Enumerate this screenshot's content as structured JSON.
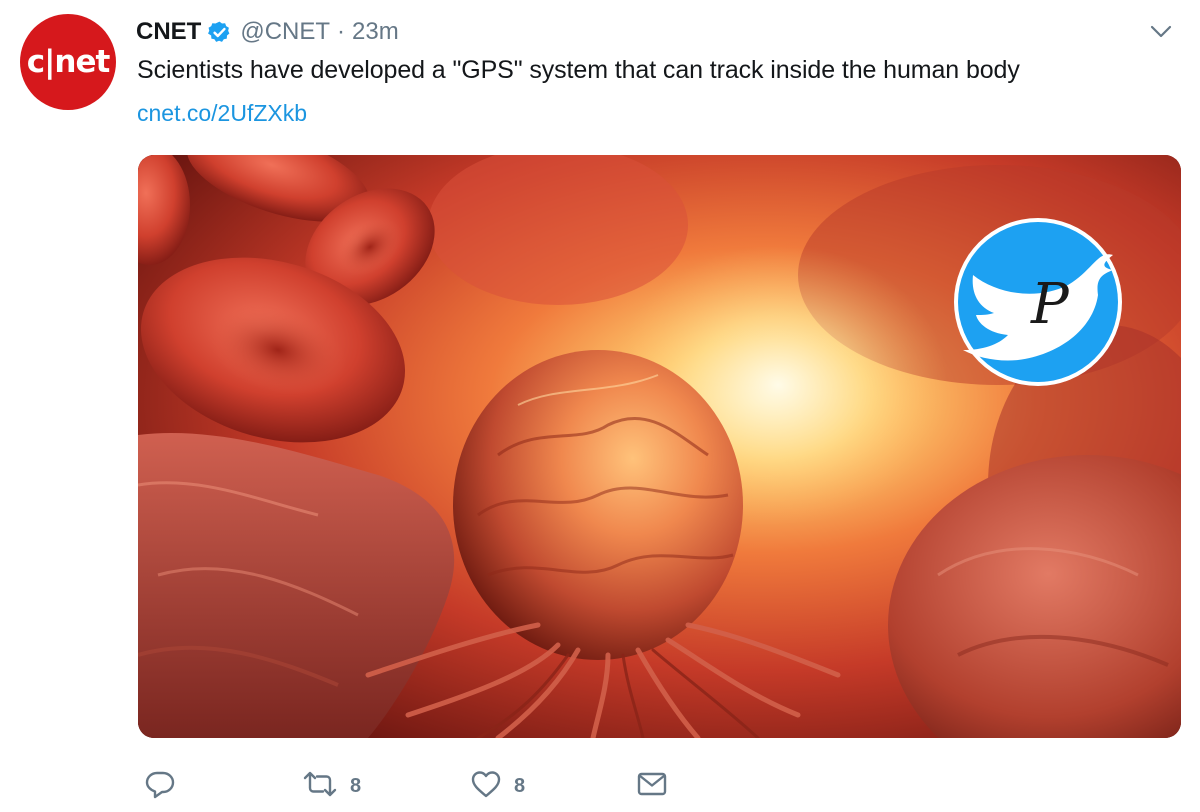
{
  "tweet": {
    "avatar_text": "c|net",
    "display_name": "CNET",
    "verified_icon": "verified-badge-icon",
    "handle": "@CNET",
    "separator": "·",
    "timestamp": "23m",
    "text": "Scientists have developed a \"GPS\" system that can track inside the human body",
    "link": "cnet.co/2UfZXkb",
    "media": {
      "description_icon": "cell-illustration-image",
      "watermark_letter": "P"
    },
    "actions": {
      "reply": {
        "icon": "reply-icon"
      },
      "retweet": {
        "icon": "retweet-icon",
        "count": "8"
      },
      "like": {
        "icon": "heart-icon",
        "count": "8"
      },
      "message": {
        "icon": "envelope-icon"
      }
    }
  },
  "colors": {
    "avatar_red": "#d6181c",
    "verified_blue": "#1da1f2",
    "link_blue": "#1b95e0",
    "muted_gray": "#657786"
  }
}
